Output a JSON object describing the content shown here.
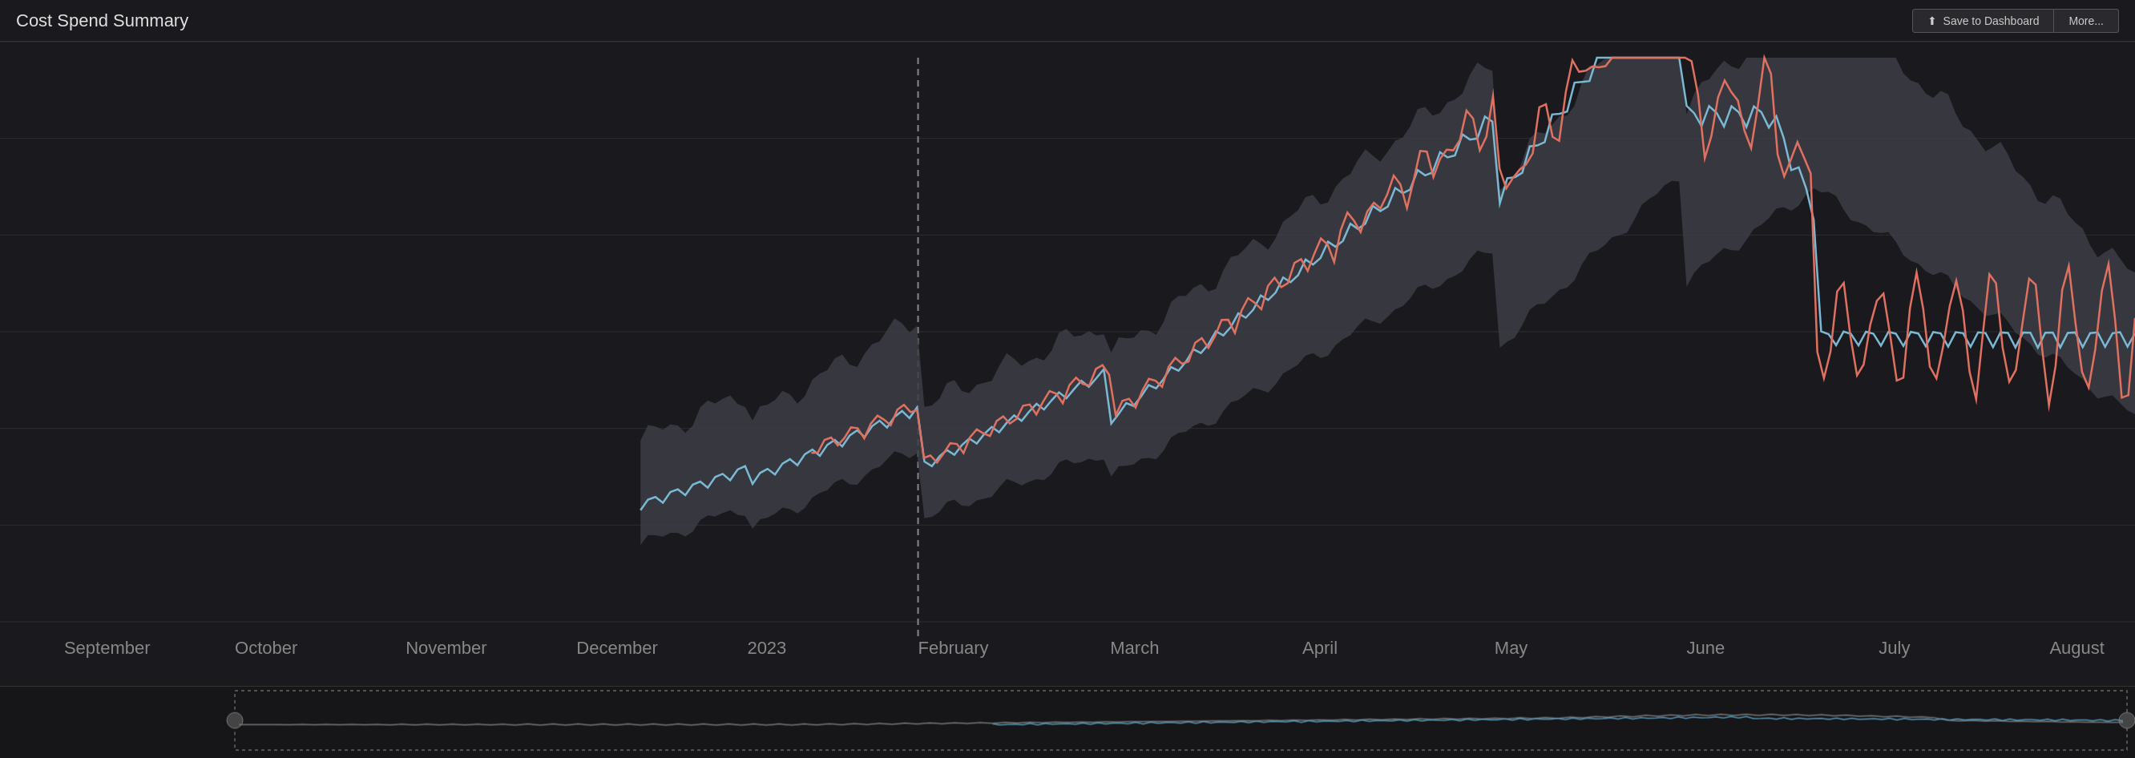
{
  "header": {
    "title": "Cost Spend Summary",
    "save_label": "Save to Dashboard",
    "more_label": "More...",
    "save_icon": "⬆"
  },
  "chart": {
    "x_labels": [
      "September",
      "October",
      "November",
      "December",
      "2023",
      "February",
      "March",
      "April",
      "May",
      "June",
      "July",
      "August"
    ],
    "colors": {
      "background": "#1a1a1e",
      "grid": "#2a2a2e",
      "area_fill": "#3a3a3e",
      "line_blue": "#7ab8d4",
      "line_red": "#e07060",
      "dashed_line_x": "#888"
    }
  }
}
